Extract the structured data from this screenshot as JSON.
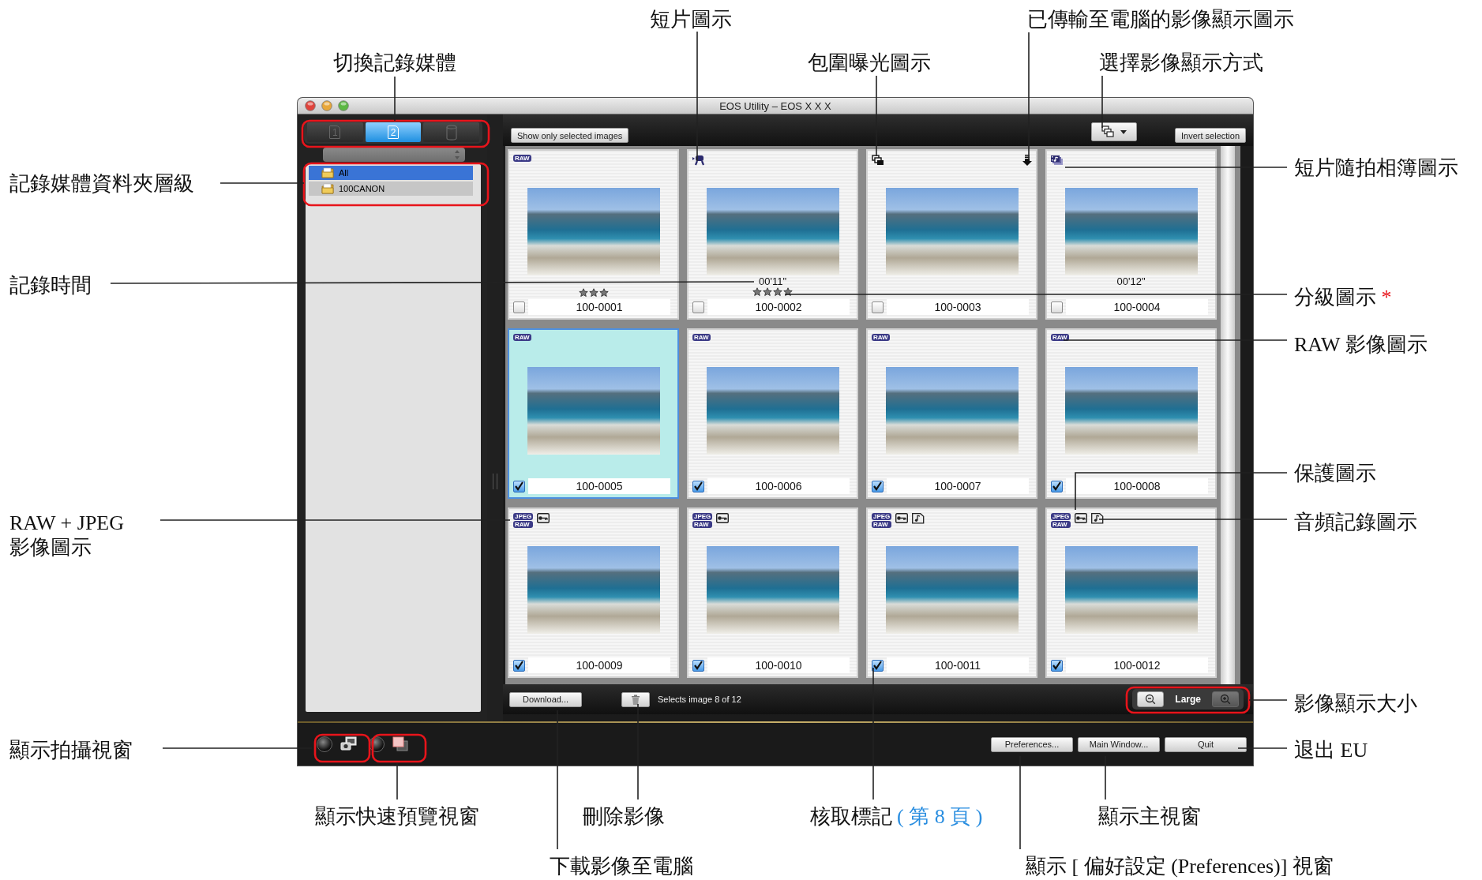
{
  "window": {
    "title": "EOS Utility – EOS X X X"
  },
  "media_tabs": [
    {
      "kind": "card",
      "label": "1",
      "selected": false
    },
    {
      "kind": "card",
      "label": "2",
      "selected": true
    },
    {
      "kind": "drive",
      "selected": false
    }
  ],
  "folders": [
    {
      "label": "All",
      "selected": true
    },
    {
      "label": "100CANON",
      "selected": false
    }
  ],
  "toolbar": {
    "filter_button": "Show only selected images",
    "invert_button": "Invert selection"
  },
  "images": [
    {
      "name": "100-0001",
      "icons": [
        {
          "kind": "format",
          "labels": [
            "RAW"
          ]
        }
      ],
      "stars": 3,
      "transferred": false,
      "checked": false,
      "selected": false
    },
    {
      "name": "100-0002",
      "icons": [
        {
          "kind": "movie"
        }
      ],
      "duration": "00'11\"",
      "stars": 4,
      "transferred": false,
      "checked": false,
      "selected": false
    },
    {
      "name": "100-0003",
      "icons": [
        {
          "kind": "bracket"
        }
      ],
      "transferred": true,
      "checked": false,
      "selected": false
    },
    {
      "name": "100-0004",
      "icons": [
        {
          "kind": "album"
        }
      ],
      "duration": "00'12\"",
      "transferred": false,
      "checked": false,
      "selected": false
    },
    {
      "name": "100-0005",
      "icons": [
        {
          "kind": "format",
          "labels": [
            "RAW"
          ]
        }
      ],
      "transferred": false,
      "checked": true,
      "selected": true
    },
    {
      "name": "100-0006",
      "icons": [
        {
          "kind": "format",
          "labels": [
            "RAW"
          ]
        }
      ],
      "transferred": false,
      "checked": true,
      "selected": false
    },
    {
      "name": "100-0007",
      "icons": [
        {
          "kind": "format",
          "labels": [
            "RAW"
          ]
        }
      ],
      "transferred": false,
      "checked": true,
      "selected": false
    },
    {
      "name": "100-0008",
      "icons": [
        {
          "kind": "format",
          "labels": [
            "RAW"
          ]
        }
      ],
      "transferred": false,
      "checked": true,
      "selected": false
    },
    {
      "name": "100-0009",
      "icons": [
        {
          "kind": "format",
          "labels": [
            "JPEG",
            "RAW"
          ]
        },
        {
          "kind": "protect"
        }
      ],
      "transferred": false,
      "checked": true,
      "selected": false
    },
    {
      "name": "100-0010",
      "icons": [
        {
          "kind": "format",
          "labels": [
            "JPEG",
            "RAW"
          ]
        },
        {
          "kind": "protect"
        }
      ],
      "transferred": false,
      "checked": true,
      "selected": false
    },
    {
      "name": "100-0011",
      "icons": [
        {
          "kind": "format",
          "labels": [
            "JPEG",
            "RAW"
          ]
        },
        {
          "kind": "protect"
        },
        {
          "kind": "audio"
        }
      ],
      "transferred": false,
      "checked": true,
      "selected": false
    },
    {
      "name": "100-0012",
      "icons": [
        {
          "kind": "format",
          "labels": [
            "JPEG",
            "RAW"
          ]
        },
        {
          "kind": "protect"
        },
        {
          "kind": "audio"
        }
      ],
      "transferred": false,
      "checked": true,
      "selected": false
    }
  ],
  "bottom_bar": {
    "download_button": "Download...",
    "status": "Selects image 8 of 12",
    "size_label": "Large"
  },
  "footer": {
    "buttons": [
      "Preferences...",
      "Main Window...",
      "Quit"
    ]
  },
  "callouts": [
    {
      "text": "切換記錄媒體"
    },
    {
      "text": "短片圖示"
    },
    {
      "text": "包圍曝光圖示"
    },
    {
      "text": "已傳輸至電腦的影像顯示圖示"
    },
    {
      "text": "選擇影像顯示方式"
    },
    {
      "text": "短片隨拍相簿圖示"
    },
    {
      "text": "記錄媒體資料夾層級"
    },
    {
      "text": "記錄時間"
    },
    {
      "text": "分級圖示",
      "mark": "*"
    },
    {
      "text": "RAW 影像圖示"
    },
    {
      "text": "保護圖示"
    },
    {
      "text": "RAW + JPEG\n影像圖示"
    },
    {
      "text": "音頻記錄圖示"
    },
    {
      "text": "影像顯示大小"
    },
    {
      "text": "顯示拍攝視窗"
    },
    {
      "text": "退出 EU"
    },
    {
      "text": "顯示快速預覽視窗"
    },
    {
      "text": "刪除影像"
    },
    {
      "text": "核取標記",
      "link": "( 第 8 頁 )"
    },
    {
      "text": "顯示主視窗"
    },
    {
      "text": "下載影像至電腦"
    },
    {
      "text": "顯示 [ 偏好設定 (Preferences)] 視窗"
    }
  ]
}
